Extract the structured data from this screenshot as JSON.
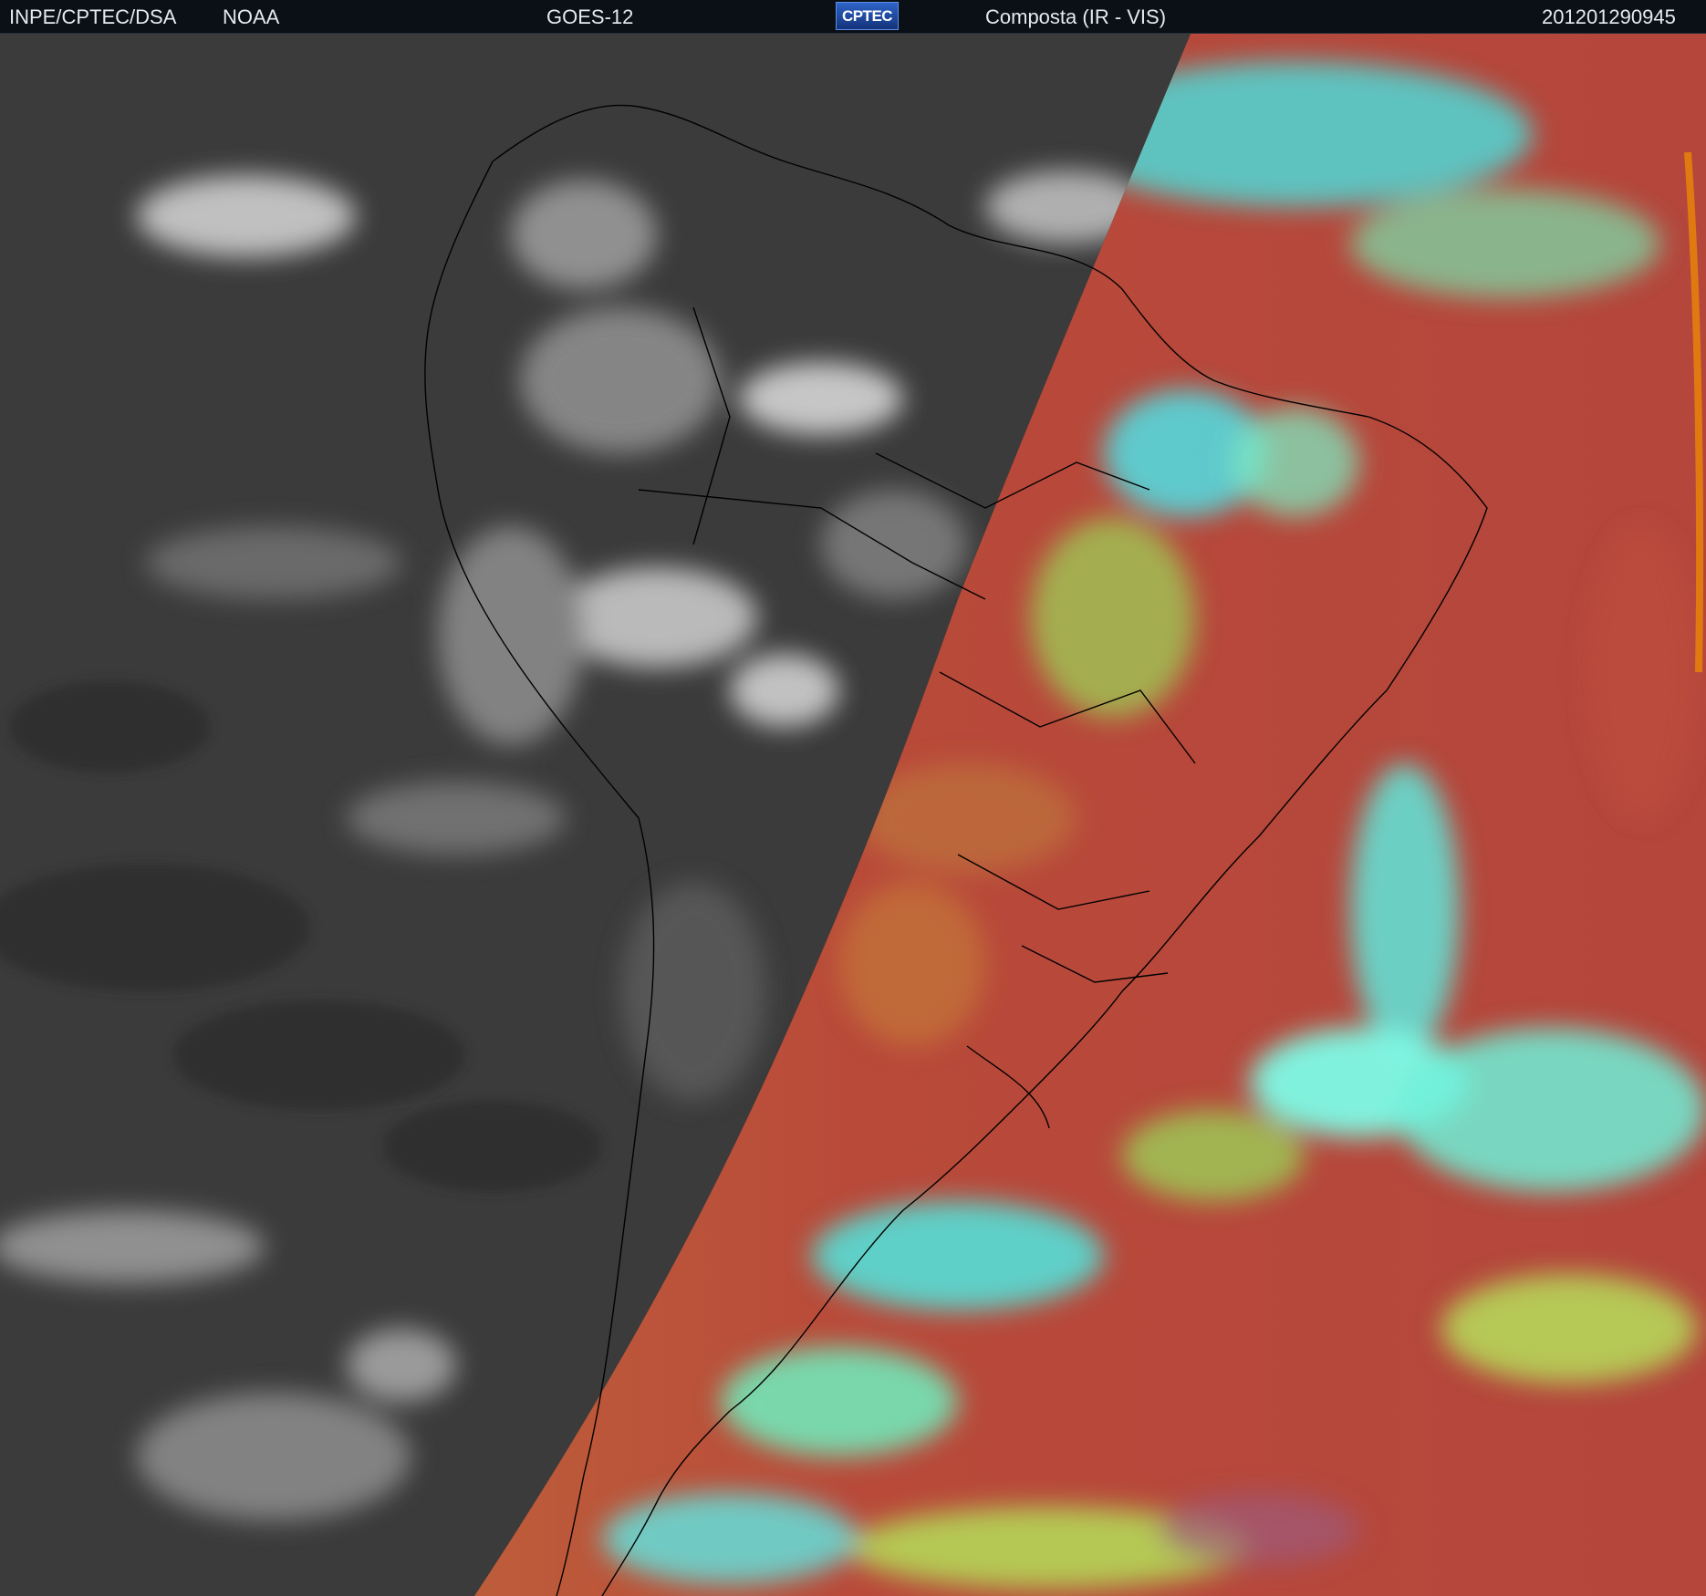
{
  "header": {
    "agency": "INPE/CPTEC/DSA",
    "source": "NOAA",
    "satellite": "GOES-12",
    "logo_text": "CPTEC",
    "product": "Composta (IR - VIS)",
    "timestamp": "201201290945"
  },
  "colors": {
    "header_bg": "#0b0f16",
    "ir_dark": "#3a3a3a",
    "ir_cloud": "#d8d8d8",
    "vis_clear": "#b24a3a",
    "vis_cloud_cyan": "#4fe8dc",
    "vis_cloud_green": "#9bd85a",
    "terminator_edge": "#e07a10",
    "coastline": "#000000"
  }
}
